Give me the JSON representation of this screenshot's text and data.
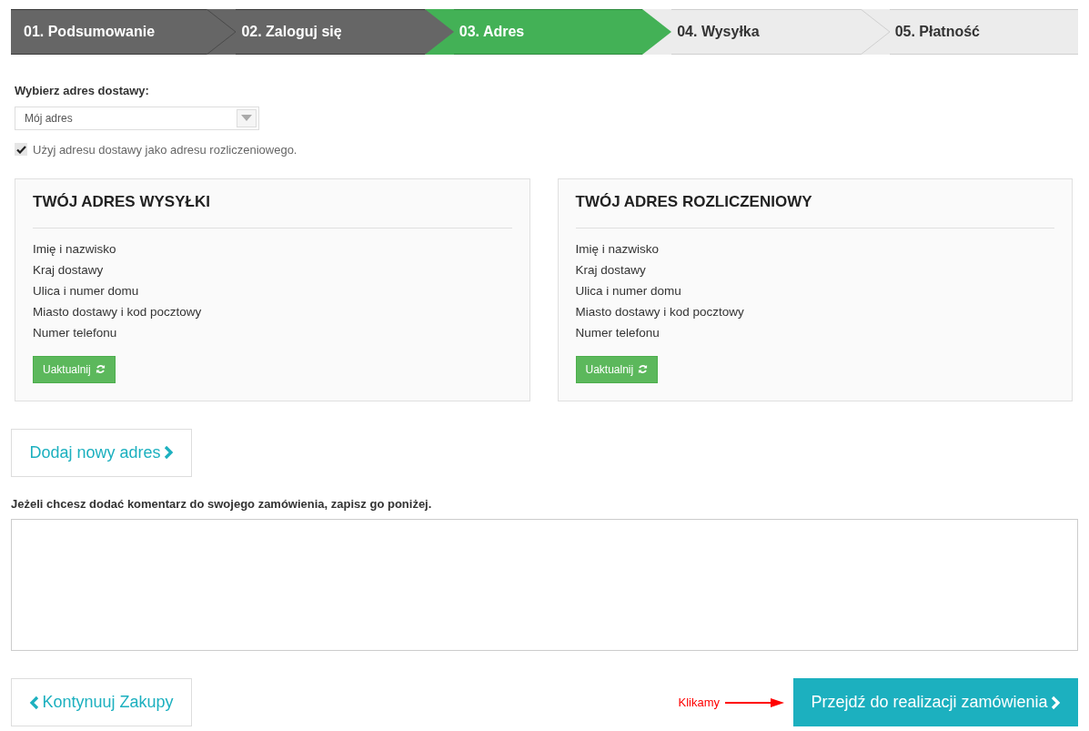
{
  "steps": [
    {
      "label": "01. Podsumowanie",
      "completed": true,
      "selected": false
    },
    {
      "label": "02. Zaloguj się",
      "completed": true,
      "selected": false
    },
    {
      "label": "03. Adres",
      "completed": false,
      "selected": true
    },
    {
      "label": "04. Wysyłka",
      "completed": false,
      "selected": false
    },
    {
      "label": "05. Płatność",
      "completed": false,
      "selected": false
    }
  ],
  "address_select": {
    "label": "Wybierz adres dostawy:",
    "value": "Mój adres"
  },
  "same_billing": {
    "label": "Użyj adresu dostawy jako adresu rozliczeniowego.",
    "checked": true
  },
  "cards": [
    {
      "title": "TWÓJ ADRES WYSYŁKI",
      "lines": [
        "Imię i nazwisko",
        "Kraj dostawy",
        "Ulica i numer domu",
        "Miasto dostawy i kod pocztowy",
        "Numer telefonu"
      ],
      "button": "Uaktualnij"
    },
    {
      "title": "TWÓJ ADRES ROZLICZENIOWY",
      "lines": [
        "Imię i nazwisko",
        "Kraj dostawy",
        "Ulica i numer domu",
        "Miasto dostawy i kod pocztowy",
        "Numer telefonu"
      ],
      "button": "Uaktualnij"
    }
  ],
  "add_address": "Dodaj nowy adres",
  "comment": {
    "label": "Jeżeli chcesz dodać komentarz do swojego zamówienia, zapisz go poniżej."
  },
  "continue_button": "Kontynuuj Zakupy",
  "annotation": "Klikamy",
  "checkout_button": "Przejdź do realizacji zamówienia"
}
